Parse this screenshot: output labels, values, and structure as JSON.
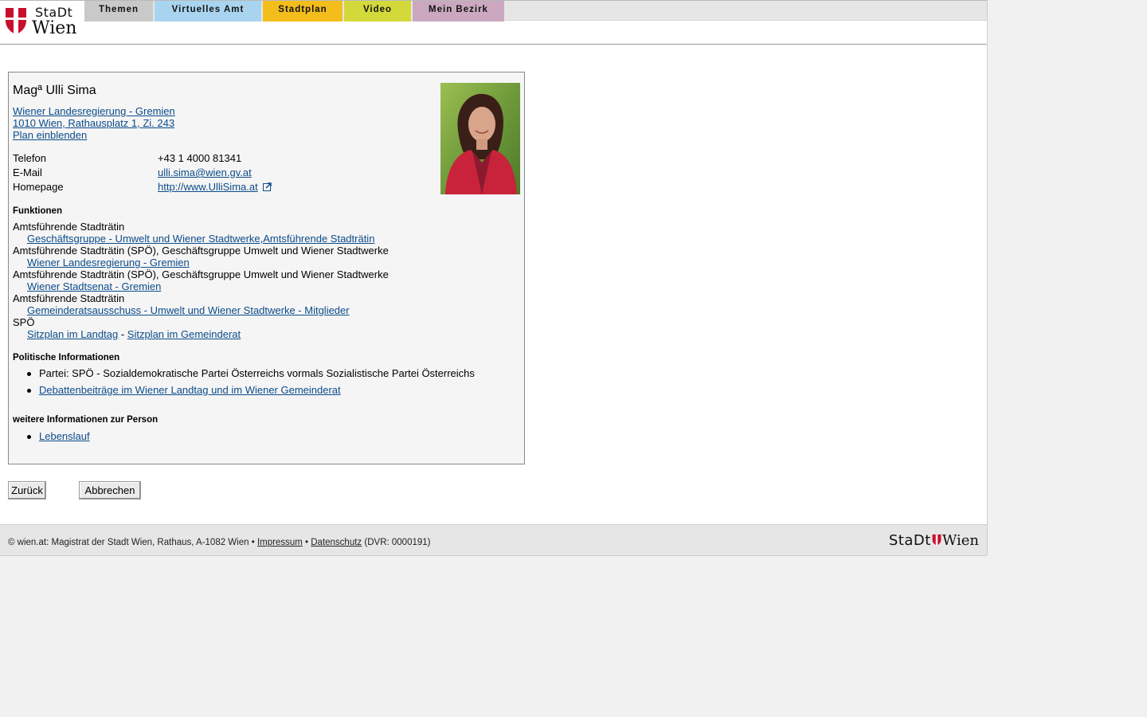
{
  "logo": {
    "line1": "StaDt",
    "line2": "Wien",
    "shield_color": "#c8102e"
  },
  "nav": {
    "tabs": [
      {
        "label": "Themen",
        "color": "#c9c9c9"
      },
      {
        "label": "Virtuelles Amt",
        "color": "#a9d4ef"
      },
      {
        "label": "Stadtplan",
        "color": "#f3bd1c"
      },
      {
        "label": "Video",
        "color": "#d3d93a"
      },
      {
        "label": "Mein Bezirk",
        "color": "#cba8c0"
      }
    ]
  },
  "person": {
    "name": "Magª Ulli Sima",
    "org_link": "Wiener Landesregierung - Gremien ",
    "address_link": "1010 Wien, Rathausplatz 1, Zi. 243",
    "plan_link": "Plan einblenden",
    "contact": [
      {
        "label": "Telefon",
        "value": "+43 1 4000 81341"
      },
      {
        "label": "E-Mail",
        "value": "ulli.sima@wien.gv.at"
      },
      {
        "label": "Homepage",
        "value": "http://www.UlliSima.at"
      }
    ]
  },
  "functions": {
    "heading": "Funktionen",
    "items": [
      {
        "role": "Amtsführende Stadträtin",
        "link": "Geschäftsgruppe - Umwelt und Wiener Stadtwerke,Amtsführende Stadträtin"
      },
      {
        "role": "Amtsführende Stadträtin (SPÖ), Geschäftsgruppe Umwelt und Wiener Stadtwerke",
        "link": "Wiener Landesregierung - Gremien"
      },
      {
        "role": "Amtsführende Stadträtin (SPÖ), Geschäftsgruppe Umwelt und Wiener Stadtwerke",
        "link": "Wiener Stadtsenat - Gremien"
      },
      {
        "role": "Amtsführende Stadträtin",
        "link": "Gemeinderatsausschuss - Umwelt und Wiener Stadtwerke - Mitglieder"
      }
    ],
    "party": "SPÖ",
    "seat_landtag": "Sitzplan im Landtag",
    "separator": "-",
    "seat_gemeinderat": "Sitzplan im Gemeinderat"
  },
  "political": {
    "heading": "Politische Informationen",
    "party_text": "Partei: SPÖ - Sozialdemokratische Partei Österreichs vormals Sozialistische Partei Österreichs",
    "debate_link": "Debattenbeiträge im Wiener Landtag und im Wiener Gemeinderat"
  },
  "more": {
    "heading": "weitere Informationen zur Person",
    "cv_link": "Lebenslauf"
  },
  "buttons": {
    "back": "Zurück",
    "cancel": "Abbrechen"
  },
  "footer": {
    "prefix": "© wien.at: Magistrat der Stadt Wien, Rathaus, A-1082 Wien •",
    "impressum": "Impressum",
    "bullet": "•",
    "datenschutz": "Datenschutz",
    "dvr": "(DVR: 0000191)",
    "logo_left": "StaDt",
    "logo_right": "Wien"
  }
}
